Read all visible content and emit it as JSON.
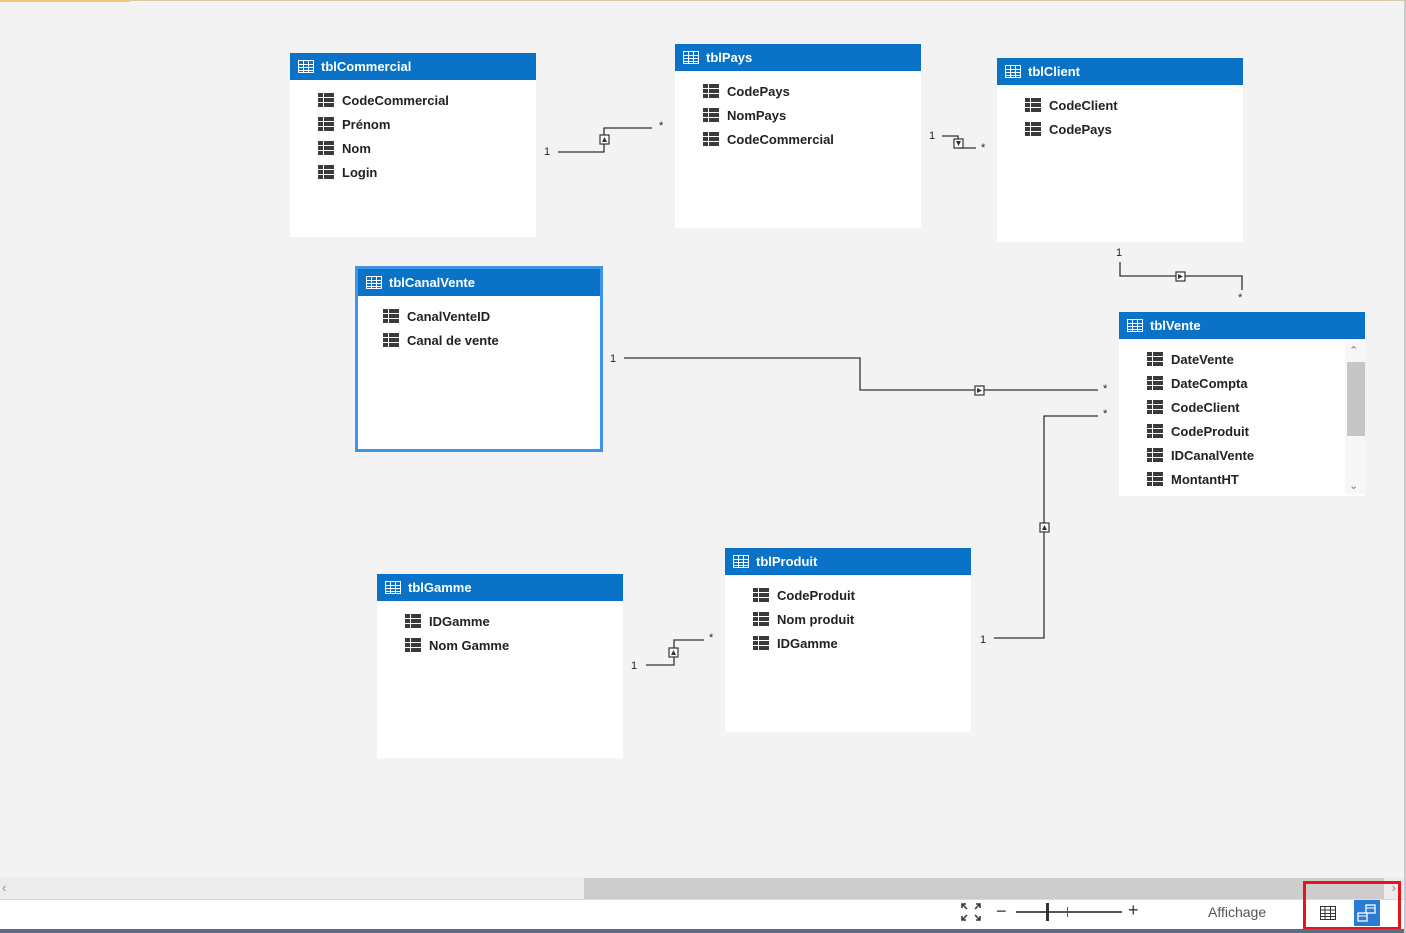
{
  "tables": {
    "commercial": {
      "name": "tblCommercial",
      "fields": [
        "CodeCommercial",
        "Prénom",
        "Nom",
        "Login"
      ]
    },
    "pays": {
      "name": "tblPays",
      "fields": [
        "CodePays",
        "NomPays",
        "CodeCommercial"
      ]
    },
    "client": {
      "name": "tblClient",
      "fields": [
        "CodeClient",
        "CodePays"
      ]
    },
    "canalvente": {
      "name": "tblCanalVente",
      "fields": [
        "CanalVenteID",
        "Canal de vente"
      ]
    },
    "vente": {
      "name": "tblVente",
      "fields": [
        "DateVente",
        "DateCompta",
        "CodeClient",
        "CodeProduit",
        "IDCanalVente",
        "MontantHT"
      ]
    },
    "gamme": {
      "name": "tblGamme",
      "fields": [
        "IDGamme",
        "Nom Gamme"
      ]
    },
    "produit": {
      "name": "tblProduit",
      "fields": [
        "CodeProduit",
        "Nom produit",
        "IDGamme"
      ]
    }
  },
  "relationships": {
    "one": "1",
    "many": "*"
  },
  "statusbar": {
    "view_label": "Affichage",
    "zoom_minus": "−",
    "zoom_plus": "+"
  },
  "colors": {
    "header_blue": "#0a73c8",
    "selected_border": "#3c95e6",
    "highlight_red": "#e8141c"
  },
  "icons": {
    "table_header": "table-icon",
    "column": "column-icon",
    "fit": "fit-to-window-icon",
    "grid_view": "grid-view-icon",
    "diagram_view": "diagram-view-icon"
  }
}
